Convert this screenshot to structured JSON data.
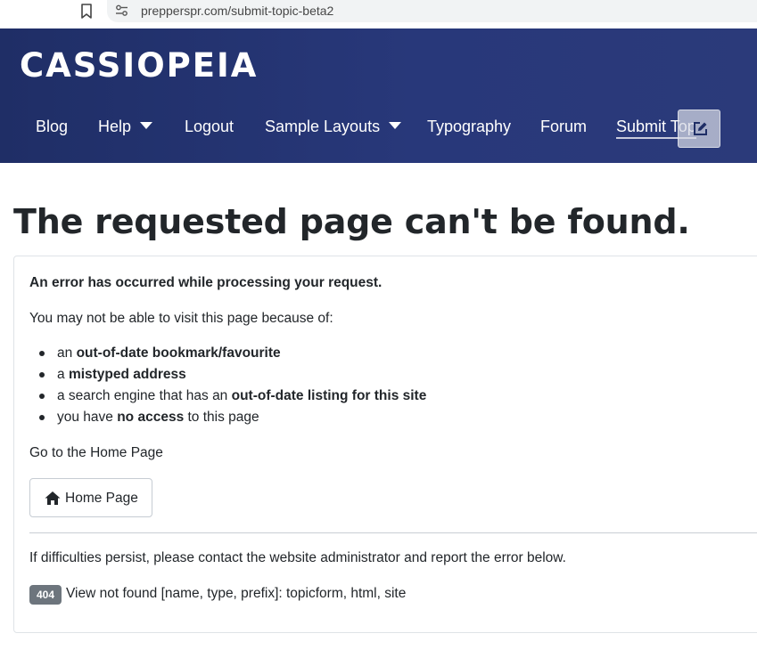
{
  "browser": {
    "url": "prepperspr.com/submit-topic-beta2",
    "icons": [
      "bookmark-icon",
      "site-info-icon"
    ]
  },
  "header": {
    "brand": "CASSIOPEIA",
    "colors": {
      "background": "#263574",
      "text": "#ffffff"
    },
    "nav": [
      {
        "label": "Blog"
      },
      {
        "label": "Help",
        "dropdown": true
      },
      {
        "label": "Logout"
      },
      {
        "label": "Sample Layouts",
        "dropdown": true
      },
      {
        "label": "Typography"
      },
      {
        "label": "Forum"
      },
      {
        "label": "Submit Topic",
        "visible_text": "Submit Top",
        "active": true
      }
    ],
    "edit_icon": "edit-icon"
  },
  "main": {
    "title": "The requested page can't be found.",
    "error_heading": "An error has occurred while processing your request.",
    "intro": "You may not be able to visit this page because of:",
    "reasons": [
      {
        "before": "an ",
        "strong": "out-of-date bookmark/favourite",
        "after": ""
      },
      {
        "before": "a ",
        "strong": "mistyped address",
        "after": ""
      },
      {
        "before": "a search engine that has an ",
        "strong": "out-of-date listing for this site",
        "after": ""
      },
      {
        "before": "you have ",
        "strong": "no access",
        "after": " to this page"
      }
    ],
    "home_prompt": "Go to the Home Page",
    "home_button": "Home Page",
    "persist_text": "If difficulties persist, please contact the website administrator and report the error below.",
    "error_code": "404",
    "error_message": "View not found [name, type, prefix]: topicform, html, site",
    "badge_color": "#6d757d"
  }
}
